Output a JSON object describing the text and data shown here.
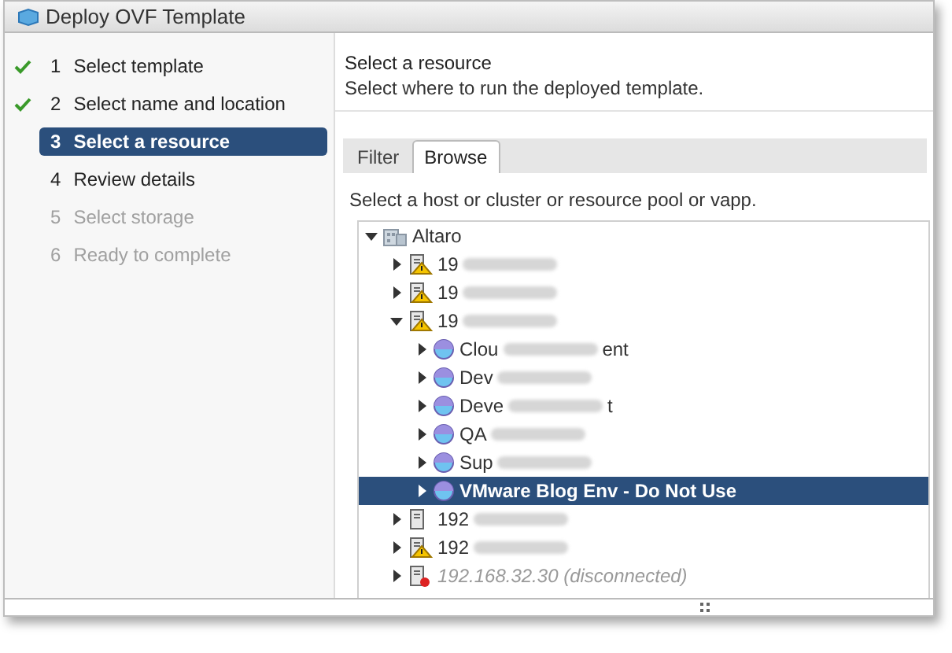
{
  "window": {
    "title": "Deploy OVF Template"
  },
  "steps": [
    {
      "number": "1",
      "label": "Select template",
      "done": true,
      "selected": false,
      "disabled": false
    },
    {
      "number": "2",
      "label": "Select name and location",
      "done": true,
      "selected": false,
      "disabled": false
    },
    {
      "number": "3",
      "label": "Select a resource",
      "done": false,
      "selected": true,
      "disabled": false
    },
    {
      "number": "4",
      "label": "Review details",
      "done": false,
      "selected": false,
      "disabled": false
    },
    {
      "number": "5",
      "label": "Select storage",
      "done": false,
      "selected": false,
      "disabled": true
    },
    {
      "number": "6",
      "label": "Ready to complete",
      "done": false,
      "selected": false,
      "disabled": true
    }
  ],
  "header": {
    "title": "Select a resource",
    "subtitle": "Select where to run the deployed template."
  },
  "tabs": [
    {
      "label": "Filter",
      "selected": false
    },
    {
      "label": "Browse",
      "selected": true
    }
  ],
  "instruction": "Select a host or cluster or resource pool or vapp.",
  "tree": [
    {
      "kind": "datacenter",
      "label": "Altaro",
      "expanded": true,
      "selected": false,
      "children": [
        {
          "kind": "host",
          "warning": true,
          "label": "19",
          "redacted": true,
          "expanded": false,
          "selected": false
        },
        {
          "kind": "host",
          "warning": true,
          "label": "19",
          "redacted": true,
          "expanded": false,
          "selected": false
        },
        {
          "kind": "host",
          "warning": true,
          "label": "19",
          "redacted": true,
          "expanded": true,
          "selected": false,
          "children": [
            {
              "kind": "pool",
              "label": "Clou",
              "redacted": true,
              "label_end": "ent",
              "expanded": false,
              "selected": false
            },
            {
              "kind": "pool",
              "label": "Dev",
              "redacted": true,
              "expanded": false,
              "selected": false
            },
            {
              "kind": "pool",
              "label": "Deve",
              "redacted": true,
              "label_end": "t",
              "expanded": false,
              "selected": false
            },
            {
              "kind": "pool",
              "label": "QA",
              "redacted": true,
              "expanded": false,
              "selected": false
            },
            {
              "kind": "pool",
              "label": "Sup",
              "redacted": true,
              "expanded": false,
              "selected": false
            },
            {
              "kind": "pool",
              "label": "VMware Blog Env - Do Not Use",
              "redacted": false,
              "expanded": false,
              "selected": true
            }
          ]
        },
        {
          "kind": "host",
          "warning": false,
          "label": "192",
          "redacted": true,
          "expanded": false,
          "selected": false
        },
        {
          "kind": "host",
          "warning": true,
          "label": "192",
          "redacted": true,
          "expanded": false,
          "selected": false
        },
        {
          "kind": "host",
          "warning": false,
          "disconnected": true,
          "label": "192.168.32.30 (disconnected)",
          "redacted": false,
          "expanded": false,
          "selected": false
        }
      ]
    }
  ]
}
